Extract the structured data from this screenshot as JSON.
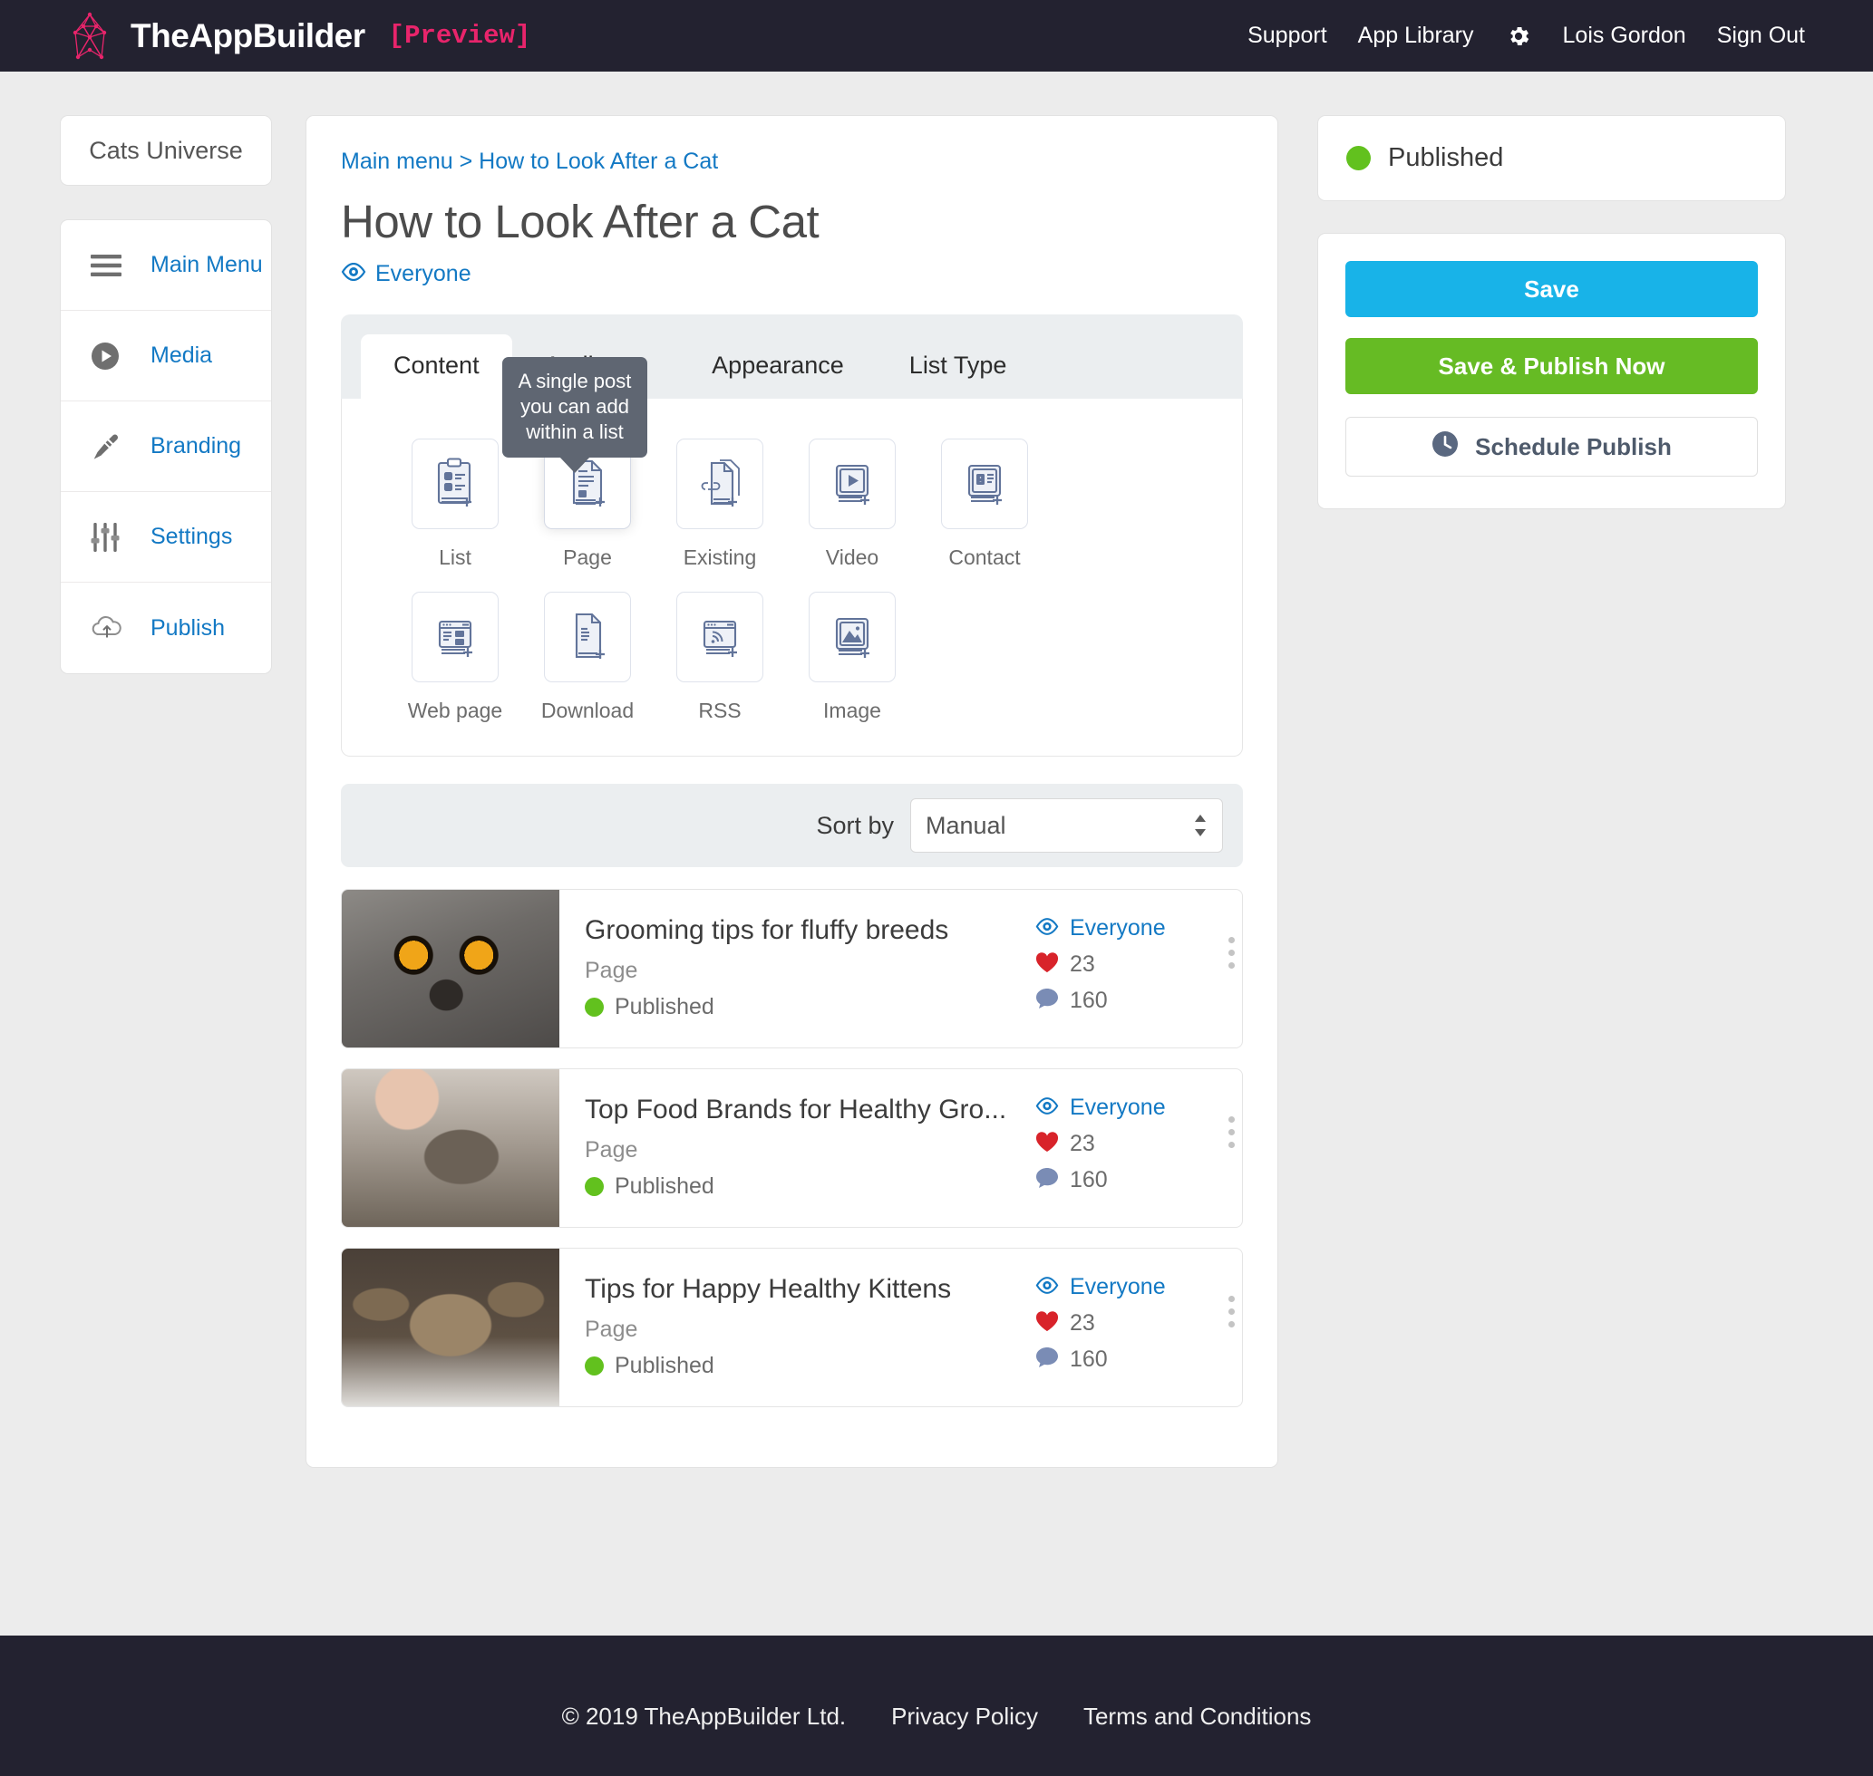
{
  "header": {
    "brand_name": "TheAppBuilder",
    "brand_preview": "[Preview]",
    "nav": [
      {
        "label": "Support"
      },
      {
        "label": "App Library"
      },
      {
        "label": "Lois Gordon"
      },
      {
        "label": "Sign Out"
      }
    ],
    "gear_icon": "gear-icon"
  },
  "sidebar": {
    "app_name": "Cats Universe",
    "items": [
      {
        "label": "Main Menu",
        "icon": "hamburger-icon"
      },
      {
        "label": "Media",
        "icon": "play-circle-icon"
      },
      {
        "label": "Branding",
        "icon": "paintbrush-icon"
      },
      {
        "label": "Settings",
        "icon": "sliders-icon"
      },
      {
        "label": "Publish",
        "icon": "cloud-upload-icon"
      }
    ]
  },
  "main": {
    "breadcrumb_root": "Main menu",
    "breadcrumb_separator": " > ",
    "breadcrumb_current": "How to Look After a Cat",
    "title": "How to Look After a Cat",
    "audience": "Everyone",
    "audience_icon": "eye-icon",
    "tabs": [
      {
        "label": "Content",
        "active": true
      },
      {
        "label": "Audience",
        "active": false
      },
      {
        "label": "Appearance",
        "active": false
      },
      {
        "label": "List Type",
        "active": false
      }
    ],
    "tooltip": "A single post you can add within a list",
    "content_types_row1": [
      {
        "label": "List",
        "icon": "clipboard-add-icon",
        "selected": false
      },
      {
        "label": "Page",
        "icon": "page-add-icon",
        "selected": true
      },
      {
        "label": "Existing",
        "icon": "existing-link-icon",
        "selected": false
      },
      {
        "label": "Video",
        "icon": "video-add-icon",
        "selected": false
      },
      {
        "label": "Contact",
        "icon": "contact-card-add-icon",
        "selected": false
      }
    ],
    "content_types_row2": [
      {
        "label": "Web page",
        "icon": "browser-add-icon",
        "selected": false
      },
      {
        "label": "Download",
        "icon": "download-doc-add-icon",
        "selected": false
      },
      {
        "label": "RSS",
        "icon": "rss-add-icon",
        "selected": false
      },
      {
        "label": "Image",
        "icon": "image-add-icon",
        "selected": false
      }
    ],
    "sort": {
      "label": "Sort by",
      "value": "Manual",
      "options": [
        "Manual"
      ]
    },
    "items": [
      {
        "title": "Grooming tips for fluffy breeds",
        "type": "Page",
        "status": "Published",
        "audience": "Everyone",
        "likes": "23",
        "comments": "160",
        "thumb": "grey-cat-closeup"
      },
      {
        "title": "Top Food Brands for Healthy Gro...",
        "type": "Page",
        "status": "Published",
        "audience": "Everyone",
        "likes": "23",
        "comments": "160",
        "thumb": "tabby-cat-petted"
      },
      {
        "title": "Tips for Happy Healthy Kittens",
        "type": "Page",
        "status": "Published",
        "audience": "Everyone",
        "likes": "23",
        "comments": "160",
        "thumb": "kittens-group"
      }
    ]
  },
  "right": {
    "status": "Published",
    "save_label": "Save",
    "publish_label": "Save & Publish Now",
    "schedule_label": "Schedule Publish",
    "schedule_icon": "clock-icon"
  },
  "footer": {
    "copyright": "© 2019 TheAppBuilder Ltd.",
    "links": [
      {
        "label": "Privacy Policy"
      },
      {
        "label": "Terms and Conditions"
      }
    ]
  },
  "colors": {
    "header_bg": "#232230",
    "brand_pink": "#e8246b",
    "link_blue": "#1379c4",
    "save_blue": "#18b3e8",
    "publish_green": "#66bb24",
    "status_green": "#62c11e",
    "heart_red": "#d8232a",
    "comment_blue": "#7a8cb5",
    "icon_slate": "#62749a"
  }
}
